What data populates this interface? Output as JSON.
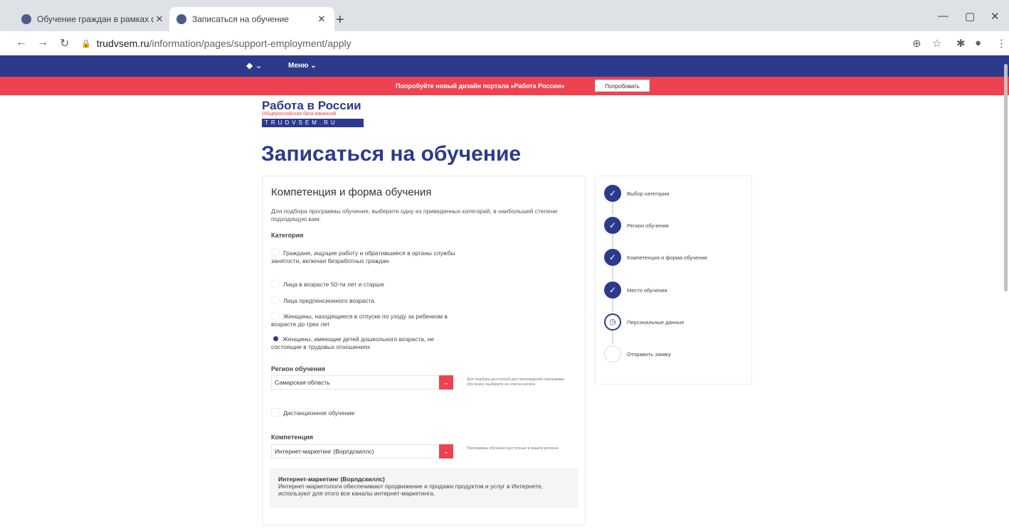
{
  "browser": {
    "tabs": [
      {
        "title": "Обучение граждан в рамках фе"
      },
      {
        "title": "Записаться на обучение"
      }
    ],
    "url_host": "trudvsem.ru",
    "url_path": "/information/pages/support-employment/apply"
  },
  "nav": {
    "menu_label": "Меню ⌄",
    "emblem": "⌄"
  },
  "promo": {
    "text": "Попробуйте новый дизайн портала «Работа России»",
    "button": "Попробовать"
  },
  "logo": {
    "main": "Работа в России",
    "sub": "Общероссийская база вакансий",
    "strip": "TRUDVSEM.RU"
  },
  "page": {
    "title": "Записаться на обучение"
  },
  "form": {
    "section_title": "Компетенция и форма обучения",
    "description": "Для подбора программы обучения, выберите одну из приведенных категорий, в наибольшей степени подходящую вам:",
    "category_label": "Категория",
    "categories": [
      "Граждане, ищущие работу и обратившиеся в органы службы занятости, включая безработных граждан",
      "Лица в возрасте 50-ти лет и старше",
      "Лица предпенсионного возраста",
      "Женщины, находящиеся в отпуске по уходу за ребенком в возрасте до трех лет",
      "Женщины, имеющие детей дошкольного возраста, не состоящие в трудовых отношениях"
    ],
    "region_label": "Регион обучения",
    "region_value": "Самарская область",
    "region_hint": "Для подбора доступной для прохождения программы обучения, выберите из списка регион",
    "distance_label": "Дистанционное обучение",
    "competence_label": "Компетенция",
    "competence_value": "Интернет-маркетинг (Ворлдскиллс)",
    "competence_hint": "Программы обучения доступные в вашем регионе",
    "info_title": "Интернет-маркетинг (Ворлдскиллс)",
    "info_text": "Интернет-маркетологи обеспечивают продвижение и продажи продуктов и услуг в Интернете, используют для этого все каналы интернет-маркетинга."
  },
  "steps": [
    {
      "label": "Выбор категории",
      "state": "done"
    },
    {
      "label": "Регион обучения",
      "state": "done"
    },
    {
      "label": "Компетенция и форма обучения",
      "state": "done"
    },
    {
      "label": "Место обучения",
      "state": "done"
    },
    {
      "label": "Персональные данные",
      "state": "current"
    },
    {
      "label": "Отправить заявку",
      "state": "todo"
    }
  ]
}
